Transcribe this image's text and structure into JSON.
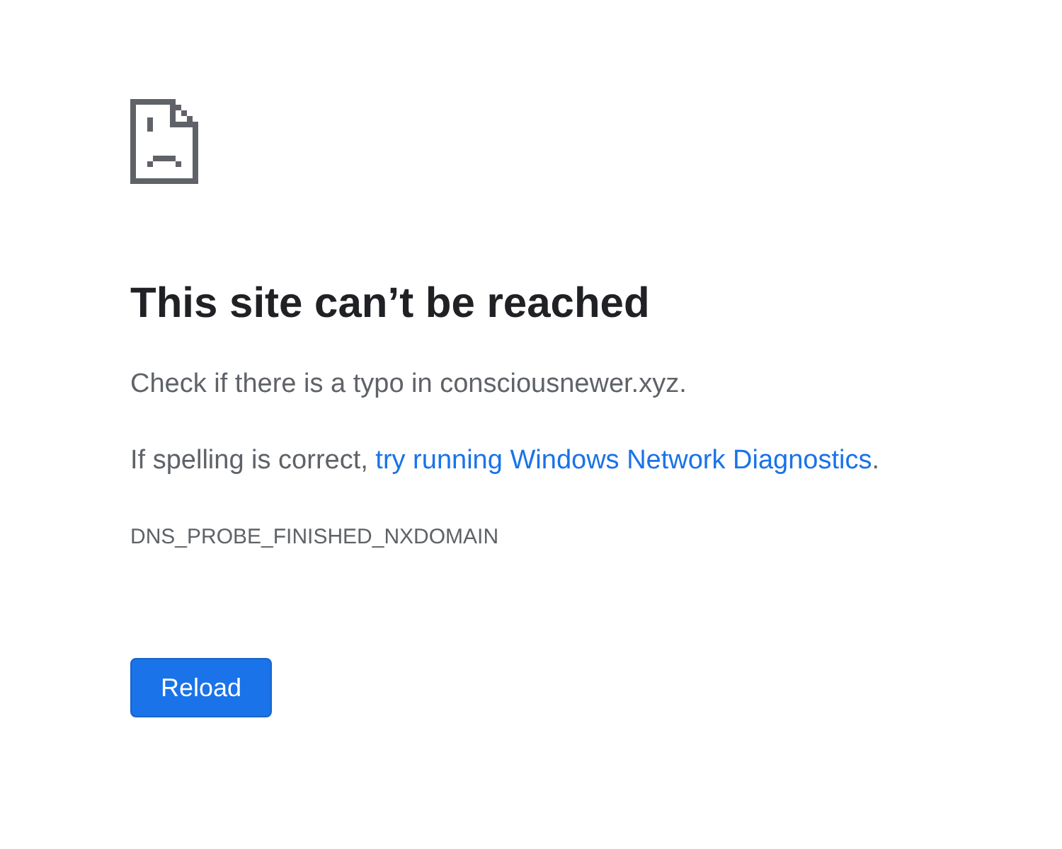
{
  "heading": "This site can’t be reached",
  "typo_hint": "Check if there is a typo in consciousnewer.xyz.",
  "diagnostics_hint": {
    "prefix": "If spelling is correct, ",
    "link": "try running Windows Network Diagnostics",
    "suffix": "."
  },
  "error_code": "DNS_PROBE_FINISHED_NXDOMAIN",
  "reload_button": "Reload"
}
